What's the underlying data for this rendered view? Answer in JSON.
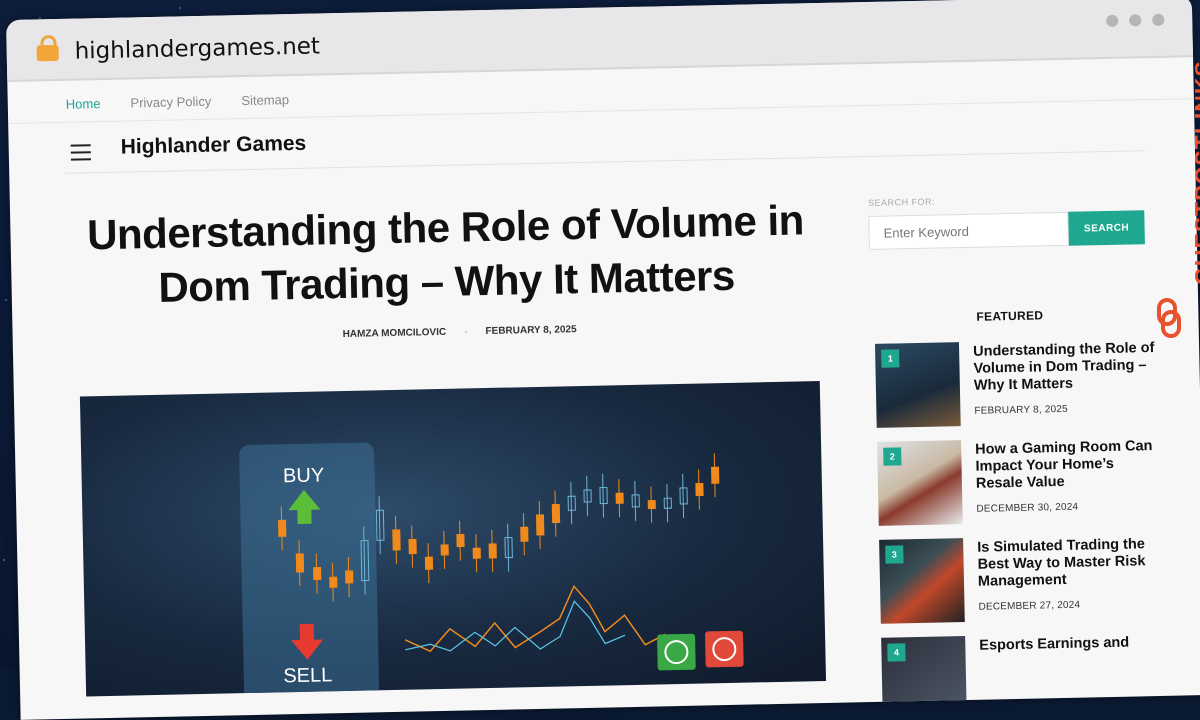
{
  "browser": {
    "url": "highlandergames.net"
  },
  "topnav": [
    {
      "label": "Home",
      "active": true
    },
    {
      "label": "Privacy Policy",
      "active": false
    },
    {
      "label": "Sitemap",
      "active": false
    }
  ],
  "header": {
    "brand": "Highlander Games"
  },
  "article": {
    "title": "Understanding the Role of Volume in Dom Trading – Why It Matters",
    "author": "HAMZA MOMCILOVIC",
    "date": "FEBRUARY 8, 2025",
    "hero": {
      "buy_label": "BUY",
      "sell_label": "SELL"
    }
  },
  "sidebar": {
    "search_label": "SEARCH FOR:",
    "search_placeholder": "Enter Keyword",
    "search_button": "SEARCH",
    "featured_heading": "FEATURED",
    "featured": [
      {
        "num": "1",
        "title": "Understanding the Role of Volume in Dom Trading – Why It Matters",
        "date": "FEBRUARY 8, 2025"
      },
      {
        "num": "2",
        "title": "How a Gaming Room Can Impact Your Home’s Resale Value",
        "date": "DECEMBER 30, 2024"
      },
      {
        "num": "3",
        "title": "Is Simulated Trading the Best Way to Master Risk Management",
        "date": "DECEMBER 27, 2024"
      },
      {
        "num": "4",
        "title": "Esports Earnings and",
        "date": ""
      }
    ]
  },
  "watermark": {
    "text": "GUESTPOSTLINKS"
  },
  "colors": {
    "accent": "#1fa88f",
    "brand_orange": "#e9512f"
  }
}
